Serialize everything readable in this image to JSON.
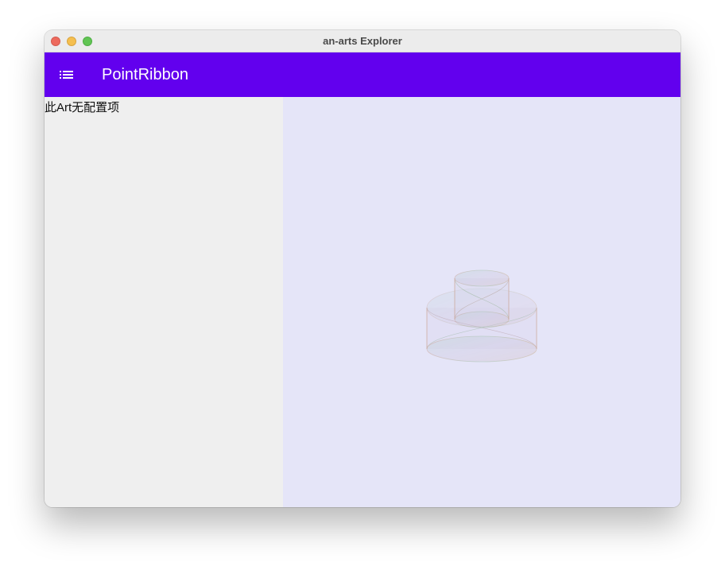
{
  "window": {
    "title": "an-arts Explorer"
  },
  "appbar": {
    "menu_icon": "list-icon",
    "title": "PointRibbon",
    "color": "#6200ee"
  },
  "sidebar": {
    "message": "此Art无配置项"
  },
  "canvas": {
    "background": "#e5e5f8"
  }
}
